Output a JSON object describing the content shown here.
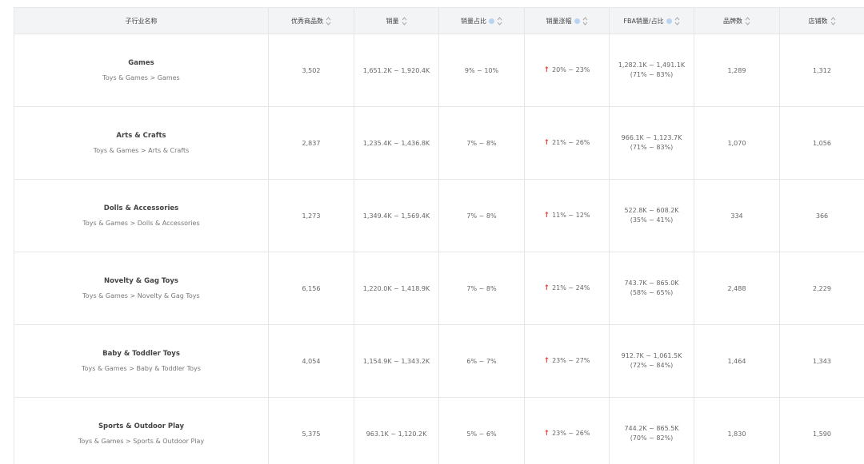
{
  "headers": {
    "name": "子行业名称",
    "good_items": "优秀商品数",
    "sales": "销量",
    "sales_share": "销量占比",
    "sales_growth": "销量涨幅",
    "fba_sales": "FBA销量/占比",
    "brands": "品牌数",
    "stores": "店铺数"
  },
  "rows": [
    {
      "name": "Games",
      "path": "Toys & Games > Games",
      "good_items": "3,502",
      "sales": "1,651.2K ~ 1,920.4K",
      "share": "9% ~ 10%",
      "growth": "20% ~ 23%",
      "fba_sales": "1,282.1K ~ 1,491.1K",
      "fba_pct": "(71% ~ 83%)",
      "brands": "1,289",
      "stores": "1,312"
    },
    {
      "name": "Arts & Crafts",
      "path": "Toys & Games > Arts & Crafts",
      "good_items": "2,837",
      "sales": "1,235.4K ~ 1,436.8K",
      "share": "7% ~ 8%",
      "growth": "21% ~ 26%",
      "fba_sales": "966.1K ~ 1,123.7K",
      "fba_pct": "(71% ~ 83%)",
      "brands": "1,070",
      "stores": "1,056"
    },
    {
      "name": "Dolls & Accessories",
      "path": "Toys & Games > Dolls & Accessories",
      "good_items": "1,273",
      "sales": "1,349.4K ~ 1,569.4K",
      "share": "7% ~ 8%",
      "growth": "11% ~ 12%",
      "fba_sales": "522.8K ~ 608.2K",
      "fba_pct": "(35% ~ 41%)",
      "brands": "334",
      "stores": "366"
    },
    {
      "name": "Novelty & Gag Toys",
      "path": "Toys & Games > Novelty & Gag Toys",
      "good_items": "6,156",
      "sales": "1,220.0K ~ 1,418.9K",
      "share": "7% ~ 8%",
      "growth": "21% ~ 24%",
      "fba_sales": "743.7K ~ 865.0K",
      "fba_pct": "(58% ~ 65%)",
      "brands": "2,488",
      "stores": "2,229"
    },
    {
      "name": "Baby & Toddler Toys",
      "path": "Toys & Games > Baby & Toddler Toys",
      "good_items": "4,054",
      "sales": "1,154.9K ~ 1,343.2K",
      "share": "6% ~ 7%",
      "growth": "23% ~ 27%",
      "fba_sales": "912.7K ~ 1,061.5K",
      "fba_pct": "(72% ~ 84%)",
      "brands": "1,464",
      "stores": "1,343"
    },
    {
      "name": "Sports & Outdoor Play",
      "path": "Toys & Games > Sports & Outdoor Play",
      "good_items": "5,375",
      "sales": "963.1K ~ 1,120.2K",
      "share": "5% ~ 6%",
      "growth": "23% ~ 26%",
      "fba_sales": "744.2K ~ 865.5K",
      "fba_pct": "(70% ~ 82%)",
      "brands": "1,830",
      "stores": "1,590"
    }
  ],
  "colors": {
    "header_bg": "#f3f4f6",
    "border": "#e6e6e6",
    "up_arrow": "#e5403c",
    "info_icon": "#b9d3f0"
  },
  "icons": {
    "sort": "sort-updown-icon",
    "info": "info-circle-icon",
    "trend": "arrow-up-icon"
  }
}
